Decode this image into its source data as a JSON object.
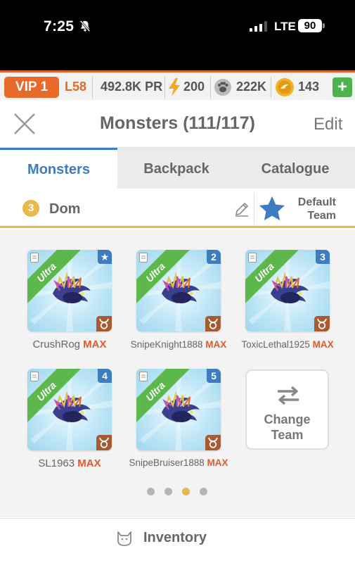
{
  "status_bar": {
    "time": "7:25",
    "network": "LTE",
    "battery": "90"
  },
  "resources": {
    "vip": "VIP 1",
    "level": "L58",
    "power": "492.8K",
    "power_unit": "PR",
    "energy": "200",
    "food": "222K",
    "coins": "143",
    "add_label": "+"
  },
  "header": {
    "title": "Monsters (111/117)",
    "edit_label": "Edit"
  },
  "tabs": [
    "Monsters",
    "Backpack",
    "Catalogue"
  ],
  "team": {
    "number": "3",
    "name": "Dom",
    "default_label_1": "Default",
    "default_label_2": "Team"
  },
  "monsters": [
    {
      "name": "CrushRog",
      "level": "MAX",
      "rarity": "Ultra",
      "slot": "★"
    },
    {
      "name": "SnipeKnight1888",
      "level": "MAX",
      "rarity": "Ultra",
      "slot": "2"
    },
    {
      "name": "ToxicLethal1925",
      "level": "MAX",
      "rarity": "Ultra",
      "slot": "3"
    },
    {
      "name": "SL1963",
      "level": "MAX",
      "rarity": "Ultra",
      "slot": "4"
    },
    {
      "name": "SnipeBruiser1888",
      "level": "MAX",
      "rarity": "Ultra",
      "slot": "5"
    }
  ],
  "change_team": {
    "line1": "Change",
    "line2": "Team"
  },
  "pagination": {
    "total": 4,
    "active": 3
  },
  "footer": {
    "inventory_label": "Inventory"
  },
  "colors": {
    "accent_blue": "#3d7cc0",
    "max_orange": "#e05a2a",
    "ultra_green": "#5cb84a",
    "team_gold": "#e8b84a",
    "vip_orange": "#e86a2a"
  },
  "icons": [
    "bell-slash-icon",
    "signal-icon",
    "battery-icon",
    "lightning-icon",
    "paw-icon",
    "coin-icon",
    "close-icon",
    "pencil-icon",
    "star-icon",
    "document-icon",
    "taurus-icon",
    "swap-icon",
    "cat-icon"
  ]
}
